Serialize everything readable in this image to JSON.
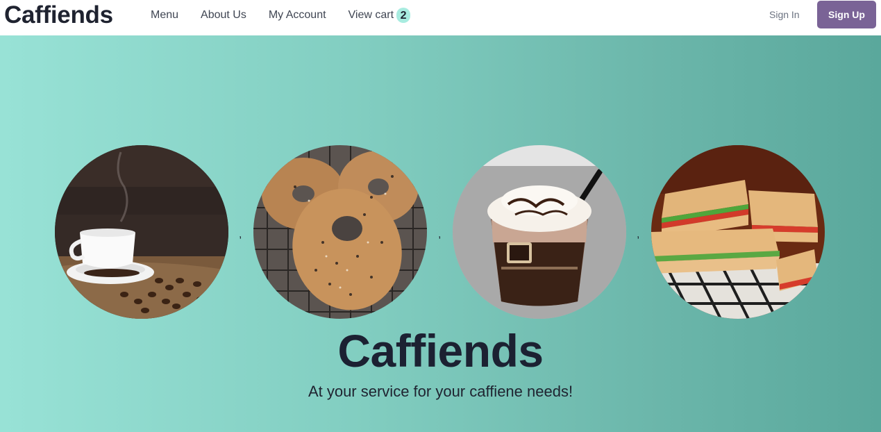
{
  "nav": {
    "brand": "Caffiends",
    "links": [
      "Menu",
      "About Us",
      "My Account",
      "View cart"
    ],
    "cart_count": "2",
    "signin": "Sign In",
    "signup": "Sign Up"
  },
  "hero": {
    "separators": [
      ",",
      ",",
      ","
    ],
    "title": "Caffiends",
    "subtitle": "At your service for your caffiene needs!"
  },
  "colors": {
    "brand_text": "#1f2330",
    "signup_bg": "#7a6396",
    "badge_bg": "#a8ece0",
    "hero_gradient_start": "#98e2d6",
    "hero_gradient_end": "#5aa89c"
  }
}
